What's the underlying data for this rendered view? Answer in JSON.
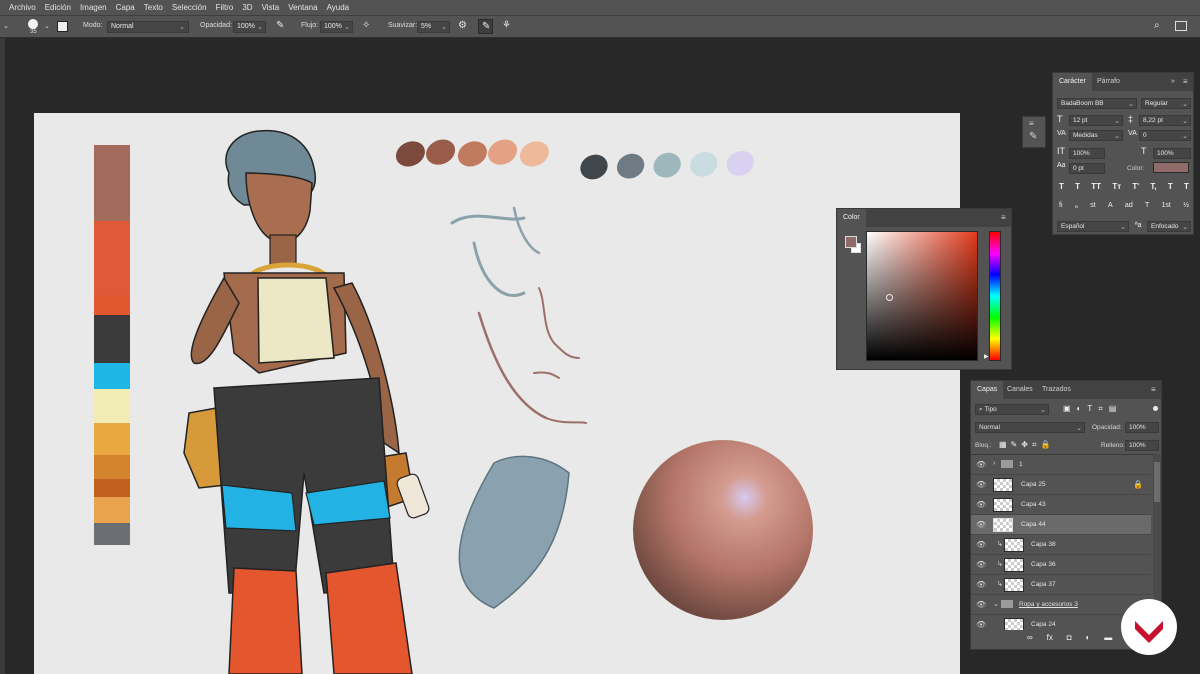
{
  "menu": [
    "Archivo",
    "Edición",
    "Imagen",
    "Capa",
    "Texto",
    "Selección",
    "Filtro",
    "3D",
    "Vista",
    "Ventana",
    "Ayuda"
  ],
  "options": {
    "brush_size": "35",
    "mode_label": "Modo:",
    "mode_value": "Normal",
    "opacity_label": "Opacidad:",
    "opacity_value": "100%",
    "flow_label": "Flujo:",
    "flow_value": "100%",
    "smooth_label": "Suavizar:",
    "smooth_value": "5%"
  },
  "character": {
    "tab_active": "Carácter",
    "tab_other": "Párrafo",
    "font_family": "BadaBoom BB",
    "font_style": "Regular",
    "font_size": "12 pt",
    "leading": "8,22 pt",
    "kerning": "Medidas",
    "tracking": "0",
    "vscale": "100%",
    "hscale": "100%",
    "baseline": "0 pt",
    "color_label": "Color:",
    "color_value": "#8e6a68",
    "language": "Español",
    "antialias": "Enfocado",
    "glyph_buttons_1": [
      "T",
      "T",
      "TT",
      "Tт",
      "T'",
      "T,",
      "T",
      "T"
    ],
    "glyph_buttons_2": [
      "fi",
      "ℴ",
      "st",
      "A",
      "ad",
      "T",
      "1st",
      "½"
    ]
  },
  "color_panel": {
    "title": "Color",
    "foreground": "#8e6a68",
    "background": "#ffffff"
  },
  "layers": {
    "tabs": [
      "Capas",
      "Canales",
      "Trazados"
    ],
    "filter": "Tipo",
    "blend": "Normal",
    "opacity_label": "Opacidad:",
    "opacity_value": "100%",
    "lock_label": "Bloq.:",
    "fill_label": "Relleno:",
    "fill_value": "100%",
    "items": [
      {
        "name": "1",
        "type": "group"
      },
      {
        "name": "Capa 25",
        "type": "layer",
        "locked": true
      },
      {
        "name": "Capa 43",
        "type": "layer"
      },
      {
        "name": "Capa 44",
        "type": "layer",
        "selected": true
      },
      {
        "name": "Capa 38",
        "type": "clip"
      },
      {
        "name": "Capa 36",
        "type": "clip"
      },
      {
        "name": "Capa 37",
        "type": "clip"
      },
      {
        "name": "Ropa y accesorios 3",
        "type": "group"
      },
      {
        "name": "Capa 24",
        "type": "layer"
      }
    ],
    "footer_icons": [
      "link-icon",
      "fx-icon",
      "mask-icon",
      "adjustment-icon",
      "folder-icon",
      "new-layer-icon",
      "trash-icon"
    ]
  },
  "palette": {
    "vertical": [
      "#a36b5c",
      "#e05a39",
      "#e2582e",
      "#3b3b3b",
      "#1fb6e6",
      "#f0ecb4",
      "#eaa940",
      "#d3842d",
      "#c0601f",
      "#e9a34c",
      "#6b6e73"
    ],
    "skin_dabs": [
      "#7b4a3d",
      "#985c48",
      "#c07a5e",
      "#e3a283",
      "#eeb99b"
    ],
    "hair_dabs": [
      "#3f464c",
      "#6f7b84",
      "#9db7bc",
      "#c9dde0",
      "#d9d1f0"
    ]
  },
  "colors": {
    "accent_logo": "#c8102e"
  }
}
